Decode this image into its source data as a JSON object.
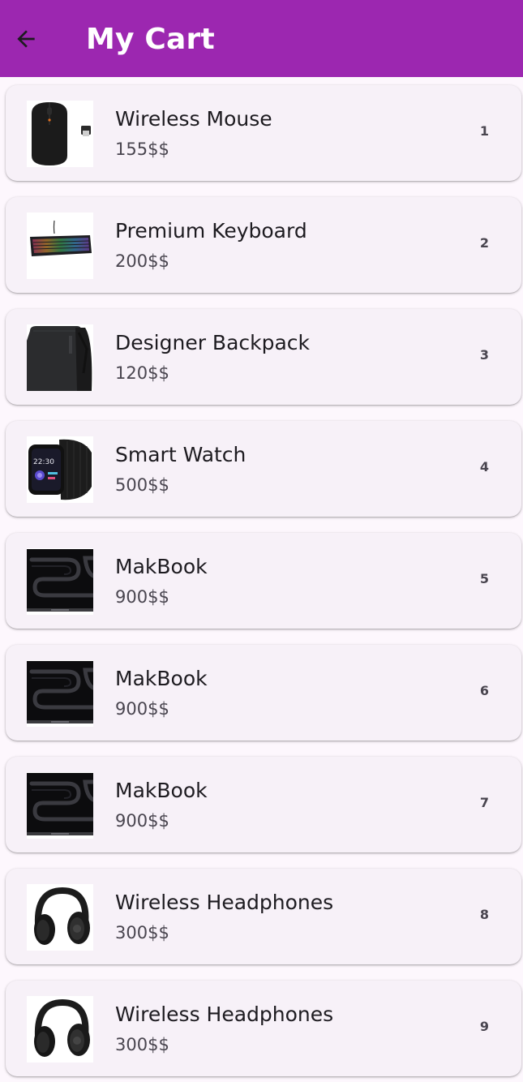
{
  "appbar": {
    "title": "My Cart",
    "back_icon": "arrow-left-icon",
    "background": "#9c27b0"
  },
  "cart": {
    "items": [
      {
        "name": "Wireless Mouse",
        "price": "155$$",
        "qty": "1",
        "image": "mouse-image"
      },
      {
        "name": "Premium Keyboard",
        "price": "200$$",
        "qty": "2",
        "image": "keyboard-image"
      },
      {
        "name": "Designer Backpack",
        "price": "120$$",
        "qty": "3",
        "image": "backpack-image"
      },
      {
        "name": "Smart Watch",
        "price": "500$$",
        "qty": "4",
        "image": "watch-image",
        "watch_time": "22:30"
      },
      {
        "name": "MakBook",
        "price": "900$$",
        "qty": "5",
        "image": "laptop-image"
      },
      {
        "name": "MakBook",
        "price": "900$$",
        "qty": "6",
        "image": "laptop-image"
      },
      {
        "name": "MakBook",
        "price": "900$$",
        "qty": "7",
        "image": "laptop-image"
      },
      {
        "name": "Wireless Headphones",
        "price": "300$$",
        "qty": "8",
        "image": "headphones-image"
      },
      {
        "name": "Wireless Headphones",
        "price": "300$$",
        "qty": "9",
        "image": "headphones-image"
      }
    ]
  }
}
